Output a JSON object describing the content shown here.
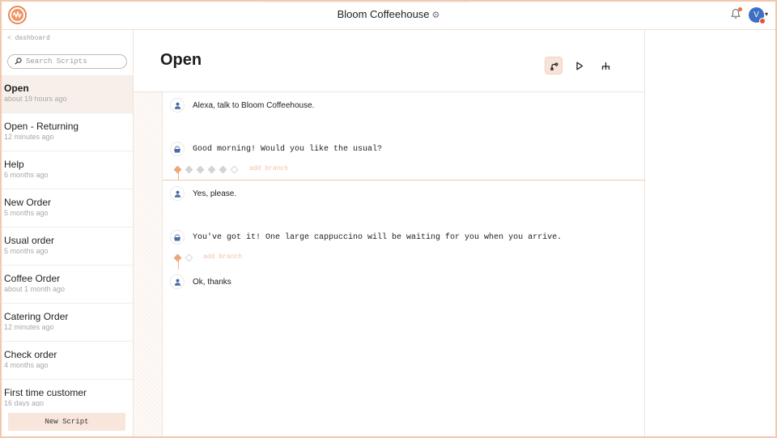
{
  "app": {
    "title": "Bloom Coffeehouse",
    "gear_glyph": "⚙",
    "avatar_initial": "V",
    "accent": "#ef9464",
    "avatar_color": "#3e6fc2"
  },
  "sidebar": {
    "back_label": "< dashboard",
    "search_placeholder": "Search Scripts",
    "items": [
      {
        "name": "Open",
        "time": "about 19 hours ago"
      },
      {
        "name": "Open - Returning",
        "time": "12 minutes ago"
      },
      {
        "name": "Help",
        "time": "6 months ago"
      },
      {
        "name": "New Order",
        "time": "5 months ago"
      },
      {
        "name": "Usual order",
        "time": "5 months ago"
      },
      {
        "name": "Coffee Order",
        "time": "about 1 month ago"
      },
      {
        "name": "Catering Order",
        "time": "12 minutes ago"
      },
      {
        "name": "Check order",
        "time": "4 months ago"
      },
      {
        "name": "First time customer",
        "time": "16 days ago"
      }
    ],
    "new_script_label": "New Script"
  },
  "main": {
    "title": "Open",
    "tools": [
      "flow-icon",
      "play-icon",
      "branch-icon"
    ],
    "turns": [
      {
        "speaker": "user",
        "text": "Alexa, talk to Bloom Coffeehouse."
      },
      {
        "speaker": "bot",
        "text": "Good morning! Would you like the usual?"
      },
      {
        "speaker": "user",
        "text": "Yes, please."
      },
      {
        "speaker": "bot",
        "text": "You've got it! One large cappuccino will be waiting for you when you arrive."
      },
      {
        "speaker": "user",
        "text": "Ok, thanks"
      }
    ],
    "add_branch_label": "add branch"
  }
}
